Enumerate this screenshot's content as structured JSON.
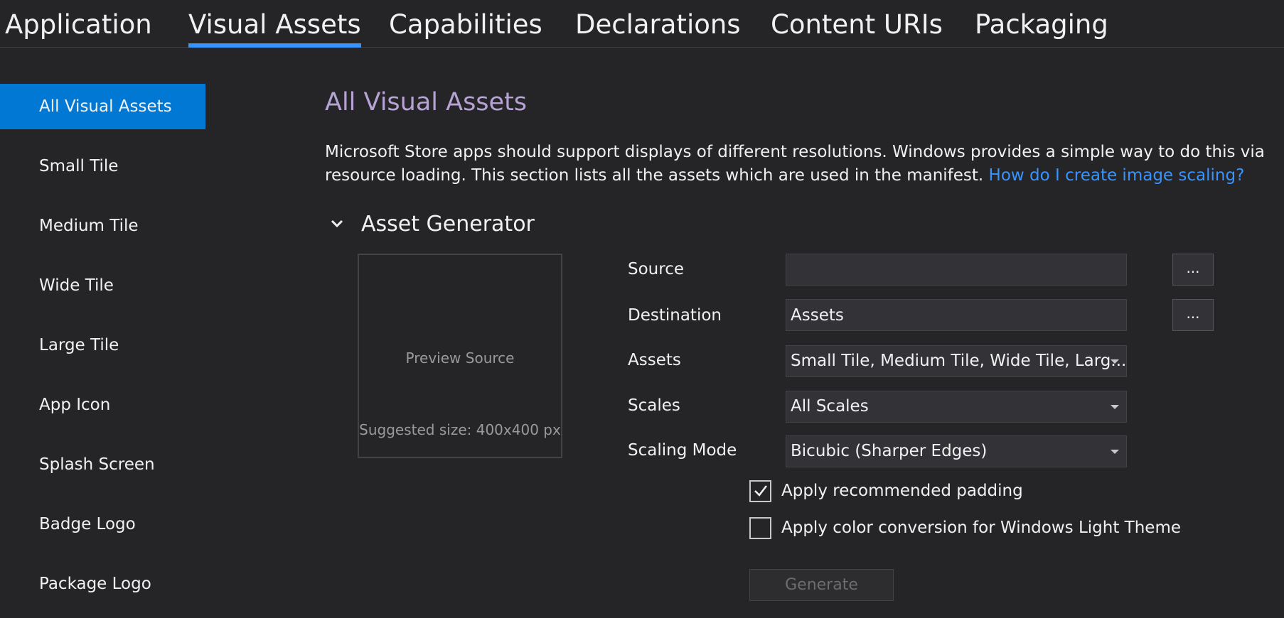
{
  "tabs": [
    {
      "label": "Application"
    },
    {
      "label": "Visual Assets"
    },
    {
      "label": "Capabilities"
    },
    {
      "label": "Declarations"
    },
    {
      "label": "Content URIs"
    },
    {
      "label": "Packaging"
    }
  ],
  "active_tab": "Visual Assets",
  "sidebar": {
    "items": [
      {
        "label": "All Visual Assets"
      },
      {
        "label": "Small Tile"
      },
      {
        "label": "Medium Tile"
      },
      {
        "label": "Wide Tile"
      },
      {
        "label": "Large Tile"
      },
      {
        "label": "App Icon"
      },
      {
        "label": "Splash Screen"
      },
      {
        "label": "Badge Logo"
      },
      {
        "label": "Package Logo"
      }
    ],
    "selected": "All Visual Assets"
  },
  "main": {
    "title": "All Visual Assets",
    "description": "Microsoft Store apps should support displays of different resolutions. Windows provides a simple way to do this via resource loading. This section lists all the assets which are used in the manifest.",
    "help_link": "How do I create image scaling?"
  },
  "generator": {
    "title": "Asset Generator",
    "preview_label": "Preview Source",
    "preview_size": "Suggested size: 400x400 px",
    "source": {
      "label": "Source",
      "value": "",
      "browse": "..."
    },
    "destination": {
      "label": "Destination",
      "value": "Assets",
      "browse": "..."
    },
    "assets": {
      "label": "Assets",
      "value": "Small Tile, Medium Tile, Wide Tile, Larg..."
    },
    "scales": {
      "label": "Scales",
      "value": "All Scales"
    },
    "scaling_mode": {
      "label": "Scaling Mode",
      "value": "Bicubic (Sharper Edges)"
    },
    "padding": {
      "label": "Apply recommended padding",
      "checked": true
    },
    "color_conversion": {
      "label": "Apply color conversion for Windows Light Theme",
      "checked": false
    },
    "generate_label": "Generate"
  },
  "colors": {
    "background": "#252528",
    "accent": "#0078d4",
    "tab_underline": "#3794ff",
    "title": "#b7a2d4",
    "link": "#3794ff"
  }
}
